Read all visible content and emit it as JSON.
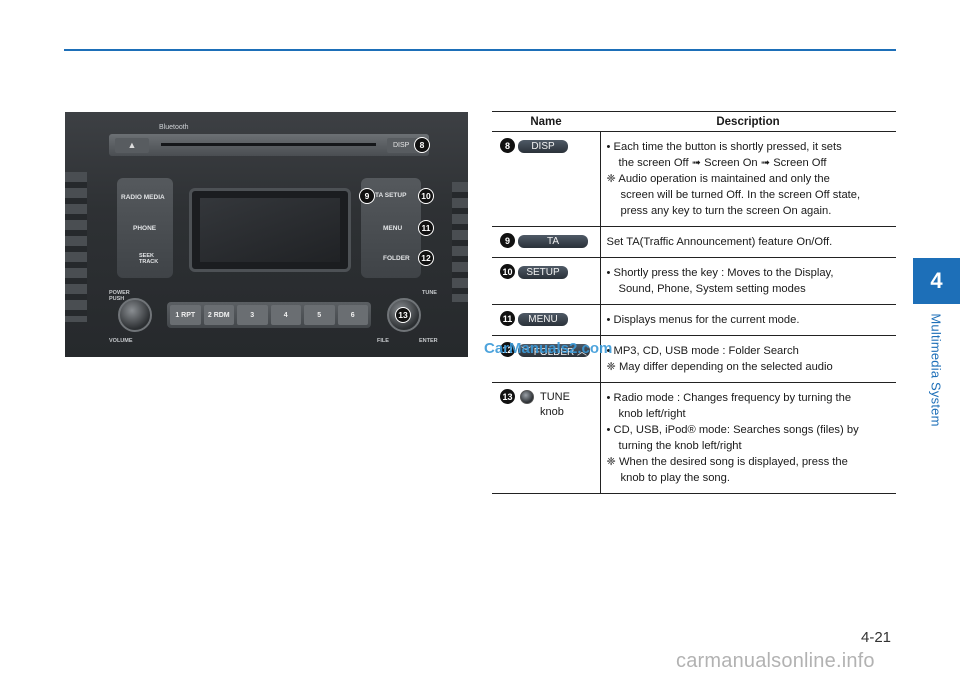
{
  "section": {
    "tab_number": "4",
    "tab_title": "Multimedia System"
  },
  "radio_image": {
    "bluetooth": "Bluetooth",
    "disp": "DISP",
    "radio_media": "RADIO  MEDIA",
    "phone": "PHONE",
    "seek_track": "SEEK TRACK",
    "ta_setup": "TA    SETUP",
    "menu": "MENU",
    "folder": "FOLDER",
    "power_push": "POWER PUSH",
    "volume": "VOLUME",
    "tune": "TUNE",
    "file": "FILE",
    "enter": "ENTER",
    "presets": [
      "1 RPT",
      "2 RDM",
      "3",
      "4",
      "5",
      "6"
    ],
    "callouts": {
      "n8": "8",
      "n9": "9",
      "n10": "10",
      "n11": "11",
      "n12": "12",
      "n13": "13"
    }
  },
  "table": {
    "headers": {
      "name": "Name",
      "description": "Description"
    },
    "rows": [
      {
        "num": "8",
        "key": "DISP",
        "lines": [
          "• Each time the button is shortly pressed, it sets",
          "the screen Off ➟ Screen On ➟ Screen Off",
          "❈ Audio operation is maintained and only the",
          "screen will be turned Off. In the screen Off state,",
          "press any key to turn the screen On again."
        ]
      },
      {
        "num": "9",
        "key": "TA",
        "lines": [
          "Set TA(Traffic Announcement) feature On/Off."
        ]
      },
      {
        "num": "10",
        "key": "SETUP",
        "lines": [
          "• Shortly press the key : Moves to the Display,",
          "Sound, Phone, System setting modes"
        ]
      },
      {
        "num": "11",
        "key": "MENU",
        "lines": [
          "• Displays menus for the current mode."
        ]
      },
      {
        "num": "12",
        "key": "﹀ FOLDER ︿",
        "lines": [
          "• MP3, CD, USB mode : Folder Search",
          "❈ May differ depending on the selected audio"
        ]
      },
      {
        "num": "13",
        "key_line1": "TUNE",
        "key_line2": "knob",
        "lines": [
          "• Radio mode : Changes frequency by turning the",
          "knob left/right",
          "• CD, USB, iPod® mode: Searches songs (files) by",
          "turning the knob left/right",
          "❈ When the desired song is displayed, press the",
          "knob to play the song."
        ]
      }
    ]
  },
  "watermark": "CarManuals2.com",
  "page_number": "4-21",
  "footer_watermark": "carmanualsonline.info"
}
